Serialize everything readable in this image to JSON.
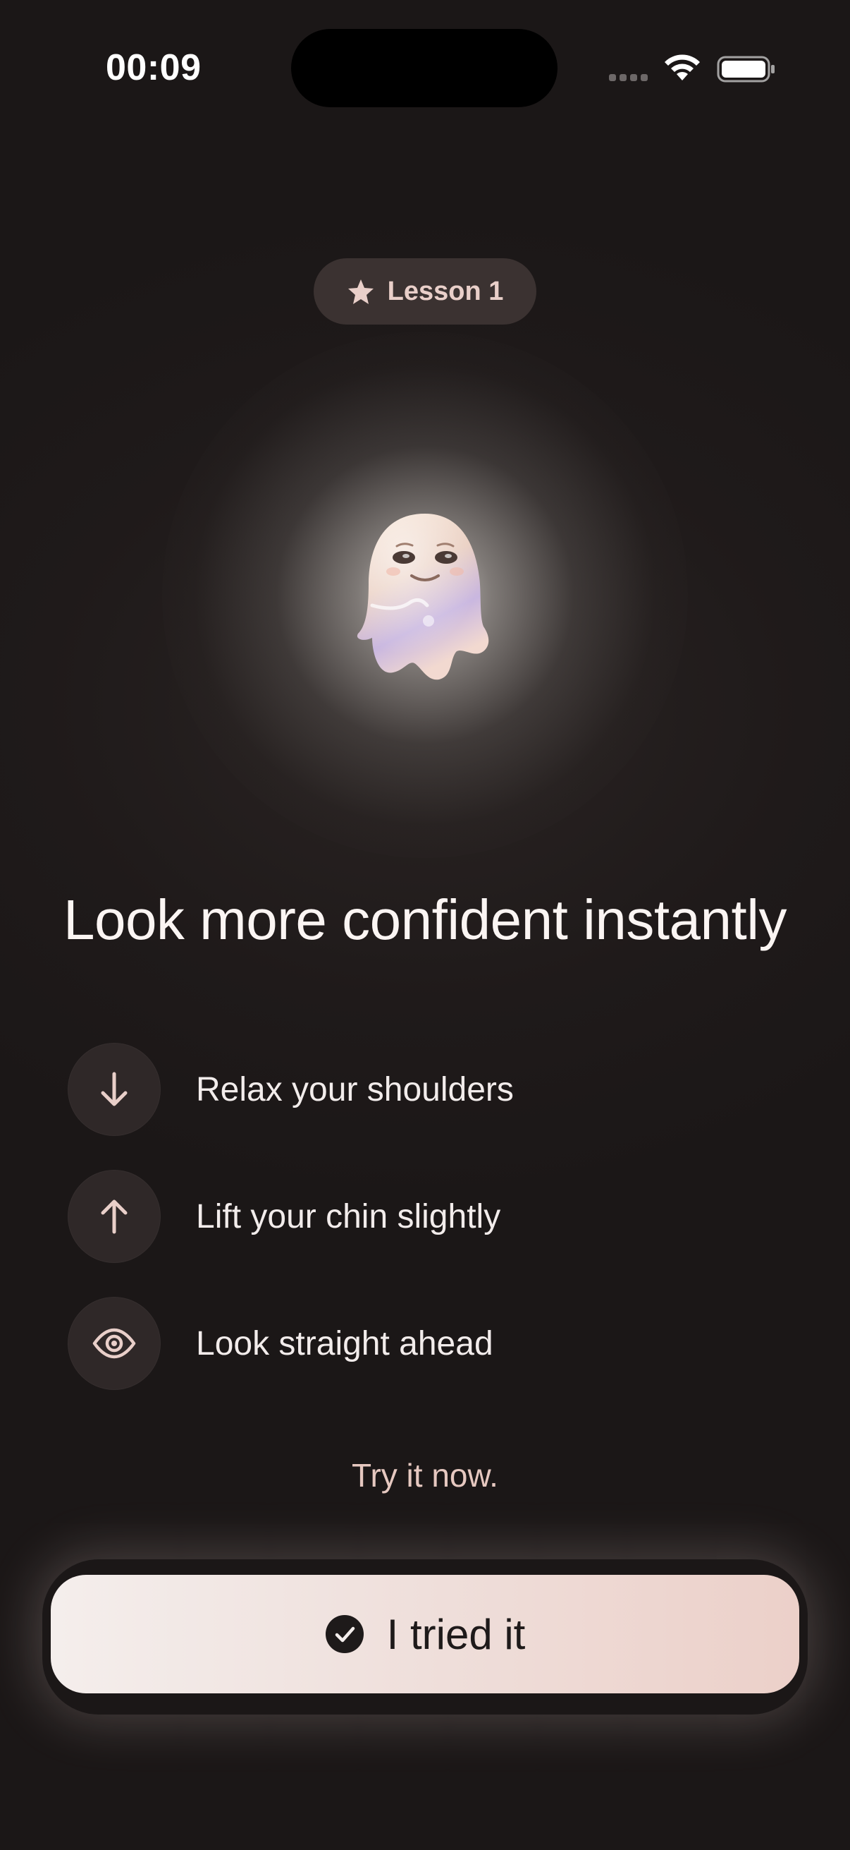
{
  "status_bar": {
    "time": "00:09"
  },
  "lesson_badge": {
    "label": "Lesson 1",
    "icon": "star-icon"
  },
  "hero": {
    "mascot": "ghost-mascot"
  },
  "title": "Look more confident instantly",
  "tips": [
    {
      "icon": "arrow-down-icon",
      "label": "Relax your shoulders"
    },
    {
      "icon": "arrow-up-icon",
      "label": "Lift your chin slightly"
    },
    {
      "icon": "eye-icon",
      "label": "Look straight ahead"
    }
  ],
  "prompt": "Try it now.",
  "cta": {
    "label": "I tried it",
    "icon": "check-circle-icon"
  },
  "colors": {
    "background": "#1c1818",
    "accent": "#e9cfc9",
    "button_start": "#f4eeec",
    "button_end": "#ecd0c9"
  }
}
